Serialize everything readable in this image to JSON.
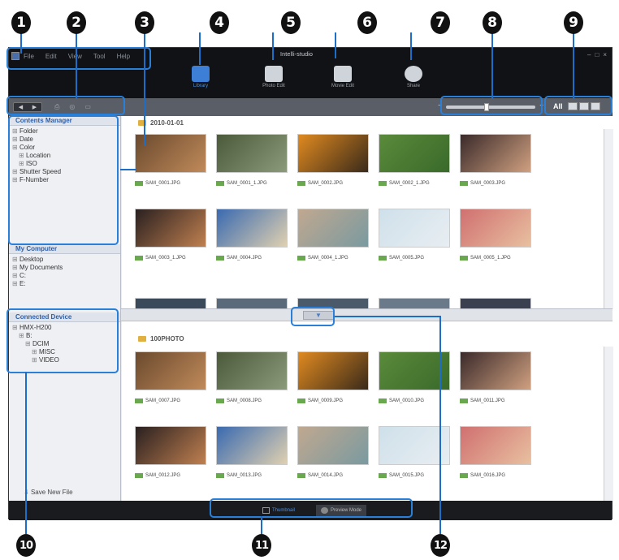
{
  "callouts": [
    "1",
    "2",
    "3",
    "4",
    "5",
    "6",
    "7",
    "8",
    "9",
    "10",
    "11",
    "12"
  ],
  "window": {
    "title": "Intelli-studio",
    "menu": [
      "File",
      "Edit",
      "View",
      "Tool",
      "Help"
    ],
    "controls": [
      "–",
      "□",
      "×"
    ]
  },
  "modes": [
    {
      "label": "Library",
      "icon": "library-icon",
      "color": "#3d7fd6"
    },
    {
      "label": "Photo Edit",
      "icon": "photo-edit-icon",
      "color": "#cfd3da"
    },
    {
      "label": "Movie Edit",
      "icon": "movie-edit-icon",
      "color": "#cfd3da"
    },
    {
      "label": "Share",
      "icon": "globe-icon",
      "color": "#cfd3da"
    }
  ],
  "toolbar": {
    "nav": [
      "◀",
      "▶"
    ],
    "icons": [
      "⎙",
      "◎",
      "▭"
    ],
    "zoom_level": 0.45,
    "view_all": "All"
  },
  "contents_manager": {
    "title": "Contents Manager",
    "items": [
      {
        "label": "Folder",
        "level": 0
      },
      {
        "label": "Date",
        "level": 0
      },
      {
        "label": "Color",
        "level": 0
      },
      {
        "label": "Location",
        "level": 1
      },
      {
        "label": "ISO",
        "level": 1
      },
      {
        "label": "Shutter Speed",
        "level": 0
      },
      {
        "label": "F-Number",
        "level": 0
      }
    ]
  },
  "my_computer": {
    "title": "My Computer",
    "items": [
      {
        "label": "Desktop",
        "level": 0
      },
      {
        "label": "My Documents",
        "level": 0
      },
      {
        "label": "C:",
        "level": 0
      },
      {
        "label": "E:",
        "level": 0
      }
    ]
  },
  "connected_device": {
    "title": "Connected Device",
    "items": [
      {
        "label": "HMX-H200",
        "level": 0
      },
      {
        "label": "B:",
        "level": 1
      },
      {
        "label": "DCIM",
        "level": 2
      },
      {
        "label": "MISC",
        "level": 3
      },
      {
        "label": "VIDEO",
        "level": 3
      }
    ],
    "save_new_file": "Save New File"
  },
  "top_folder": "2010-01-01",
  "bottom_folder": "100PHOTO",
  "top_photos": [
    {
      "name": "SAM_0001.JPG",
      "c1": "#6b4a2e",
      "c2": "#c08a5a"
    },
    {
      "name": "SAM_0001_1.JPG",
      "c1": "#4a5a3a",
      "c2": "#8a9a7a"
    },
    {
      "name": "SAM_0002.JPG",
      "c1": "#e08a20",
      "c2": "#3a2a1a"
    },
    {
      "name": "SAM_0002_1.JPG",
      "c1": "#5a8a3a",
      "c2": "#3a6a2a"
    },
    {
      "name": "SAM_0003.JPG",
      "c1": "#3a2a2a",
      "c2": "#d0a080"
    },
    {
      "name": "SAM_0003_1.JPG",
      "c1": "#2a2020",
      "c2": "#c08050"
    },
    {
      "name": "SAM_0004.JPG",
      "c1": "#3a6ab0",
      "c2": "#e0d0b0"
    },
    {
      "name": "SAM_0004_1.JPG",
      "c1": "#c0a890",
      "c2": "#7a9aa0"
    },
    {
      "name": "SAM_0005.JPG",
      "c1": "#cfe0ea",
      "c2": "#e8eef2"
    },
    {
      "name": "SAM_0005_1.JPG",
      "c1": "#d07070",
      "c2": "#e8c0a0"
    }
  ],
  "bottom_photos": [
    {
      "name": "SAM_0007.JPG",
      "c1": "#6b4a2e",
      "c2": "#c08a5a"
    },
    {
      "name": "SAM_0008.JPG",
      "c1": "#4a5a3a",
      "c2": "#8a9a7a"
    },
    {
      "name": "SAM_0009.JPG",
      "c1": "#e08a20",
      "c2": "#3a2a1a"
    },
    {
      "name": "SAM_0010.JPG",
      "c1": "#5a8a3a",
      "c2": "#3a6a2a"
    },
    {
      "name": "SAM_0011.JPG",
      "c1": "#3a2a2a",
      "c2": "#d0a080"
    },
    {
      "name": "SAM_0012.JPG",
      "c1": "#2a2020",
      "c2": "#c08050"
    },
    {
      "name": "SAM_0013.JPG",
      "c1": "#3a6ab0",
      "c2": "#e0d0b0"
    },
    {
      "name": "SAM_0014.JPG",
      "c1": "#c0a890",
      "c2": "#7a9aa0"
    },
    {
      "name": "SAM_0015.JPG",
      "c1": "#cfe0ea",
      "c2": "#e8eef2"
    },
    {
      "name": "SAM_0016.JPG",
      "c1": "#d07070",
      "c2": "#e8c0a0"
    }
  ],
  "bottom_bar": {
    "tabs": [
      "Thumbnail",
      "Preview Mode"
    ]
  }
}
